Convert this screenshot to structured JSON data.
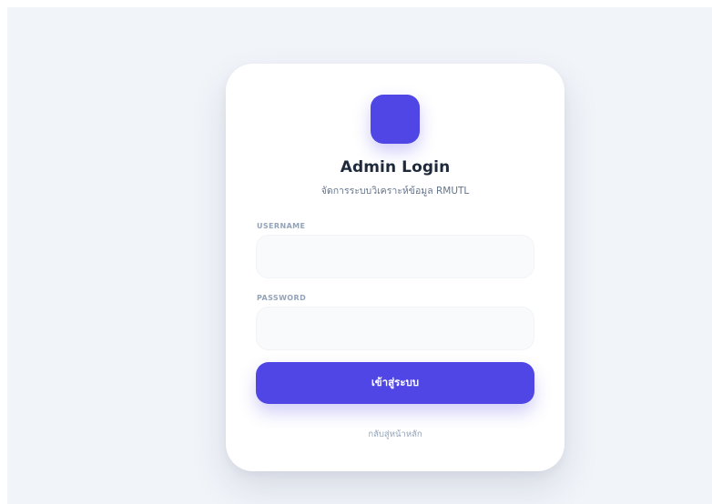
{
  "colors": {
    "page_background": "#f1f4f9",
    "card_background": "#ffffff",
    "accent": "#4f46e5",
    "title": "#1e293b",
    "muted": "#94a3b8"
  },
  "login": {
    "logo_icon": "square-logo-icon",
    "title": "Admin Login",
    "subtitle": "จัดการระบบวิเคราะห์ข้อมูล RMUTL",
    "username": {
      "label": "USERNAME",
      "value": "",
      "placeholder": ""
    },
    "password": {
      "label": "PASSWORD",
      "value": "",
      "placeholder": ""
    },
    "submit_label": "เข้าสู่ระบบ",
    "back_link_label": "กลับสู่หน้าหลัก"
  }
}
